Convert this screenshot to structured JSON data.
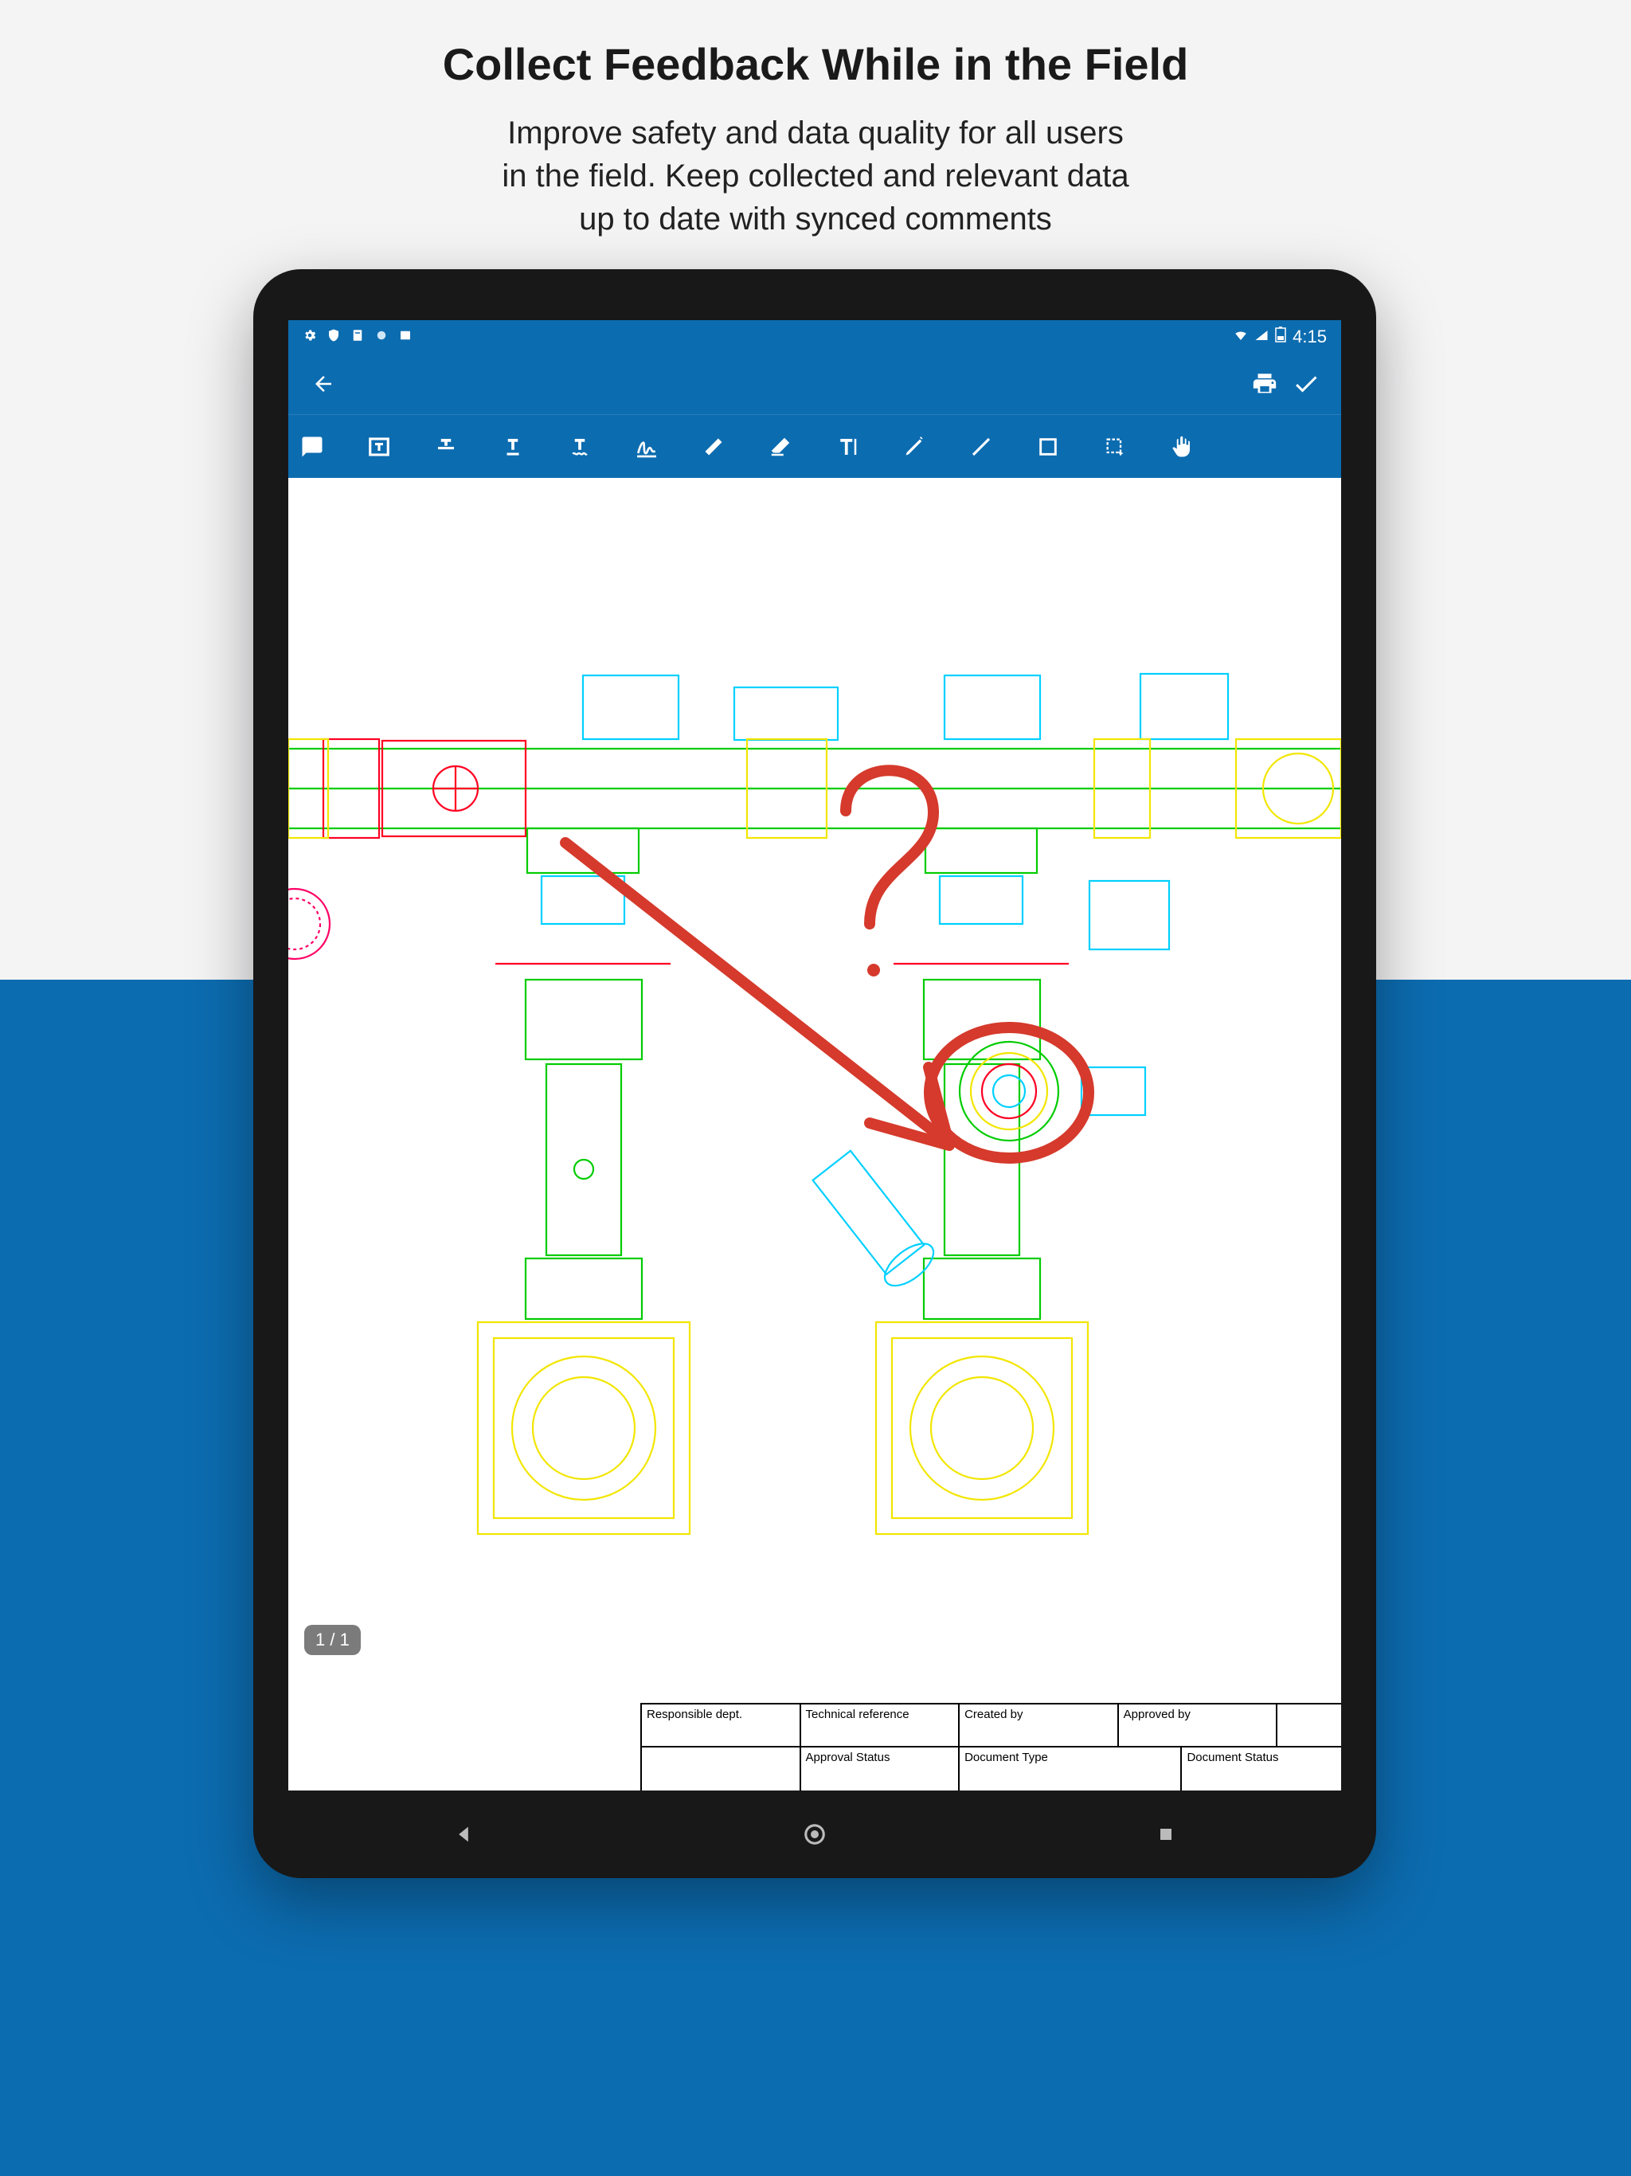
{
  "promo": {
    "title": "Collect Feedback While in the Field",
    "subtitle_l1": "Improve safety and data quality for all users",
    "subtitle_l2": "in the field. Keep collected and relevant data",
    "subtitle_l3": "up to date with synced comments"
  },
  "status": {
    "time": "4:15",
    "icons": {
      "gear": "gear",
      "shield": "shield",
      "doc": "doc",
      "circle": "circle",
      "card": "card",
      "wifi": "wifi",
      "signal": "signal",
      "battery": "battery"
    }
  },
  "appbar": {
    "back": "←",
    "print": "print",
    "confirm": "✓"
  },
  "toolbar": {
    "comment": "comment",
    "textbox": "textbox",
    "strikethrough": "strikethrough",
    "underline": "underline",
    "squiggly": "squiggly",
    "signature": "signature",
    "highlight": "highlight",
    "eraser": "eraser",
    "text": "text",
    "pen": "pen",
    "line": "line",
    "rect": "rect",
    "select": "select",
    "pan": "pan"
  },
  "page_indicator": "1 / 1",
  "title_block": {
    "row1": {
      "responsible_dept": "Responsible dept.",
      "technical_ref": "Technical reference",
      "created_by": "Created by",
      "approved_by": "Approved by"
    },
    "row2": {
      "approval_status": "Approval Status",
      "document_type": "Document Type",
      "document_status": "Document Status"
    }
  },
  "nav": {
    "back": "back",
    "home": "home",
    "recent": "recent"
  }
}
